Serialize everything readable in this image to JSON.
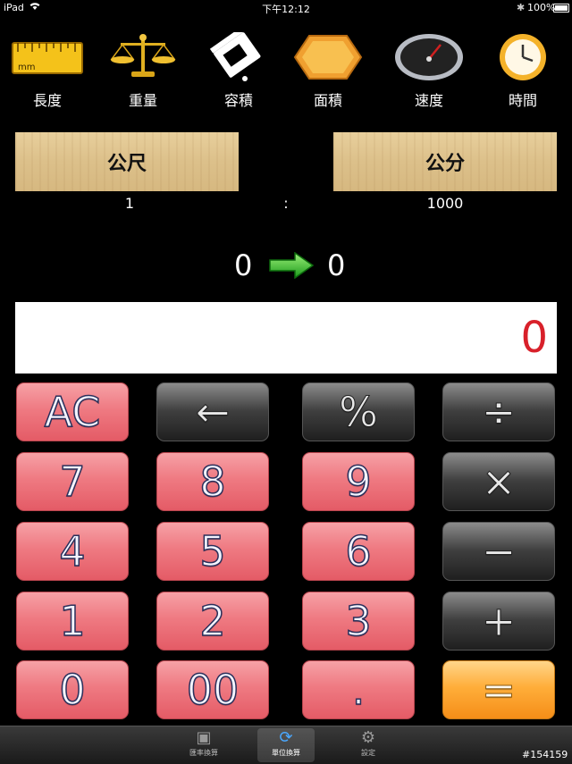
{
  "status_bar": {
    "carrier": "iPad",
    "time": "下午12:12",
    "battery": "100%"
  },
  "categories": [
    {
      "label": "長度",
      "icon": "ruler-icon"
    },
    {
      "label": "重量",
      "icon": "scale-icon"
    },
    {
      "label": "容積",
      "icon": "carton-icon"
    },
    {
      "label": "面積",
      "icon": "hexagon-tile-icon"
    },
    {
      "label": "速度",
      "icon": "speedometer-icon"
    },
    {
      "label": "時間",
      "icon": "clock-icon"
    }
  ],
  "ruler_text": "mm",
  "units": {
    "from": "公尺",
    "to": "公分",
    "from_ratio": "1",
    "separator": ":",
    "to_ratio": "1000"
  },
  "conversion": {
    "input": "0",
    "output": "0"
  },
  "display": {
    "value": "0"
  },
  "keys": {
    "ac": "AC",
    "backspace": "←",
    "percent": "%",
    "divide": "÷",
    "seven": "7",
    "eight": "8",
    "nine": "9",
    "multiply": "×",
    "four": "4",
    "five": "5",
    "six": "6",
    "minus": "−",
    "one": "1",
    "two": "2",
    "three": "3",
    "plus": "+",
    "zero": "0",
    "double_zero": "00",
    "decimal": ".",
    "equals": "="
  },
  "tabbar": {
    "tabs": [
      {
        "label": "匯率換算",
        "icon": "exchange-icon"
      },
      {
        "label": "單位換算",
        "icon": "refresh-icon"
      },
      {
        "label": "設定",
        "icon": "gear-icon"
      }
    ]
  },
  "watermark": "#154159",
  "colors": {
    "display_digit": "#d8202a",
    "red_key": "#ef7a82",
    "grey_key": "#3f3f3f",
    "orange_key": "#ffae3a"
  }
}
